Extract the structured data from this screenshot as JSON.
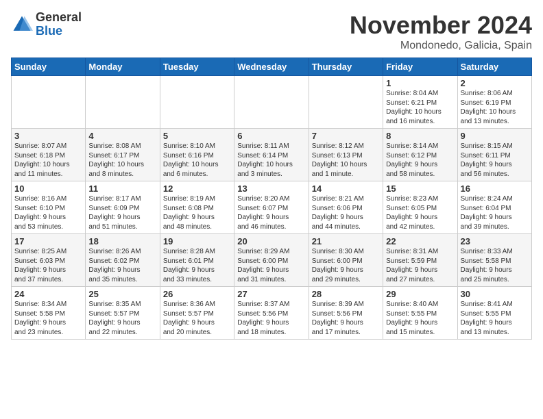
{
  "header": {
    "logo_general": "General",
    "logo_blue": "Blue",
    "month_title": "November 2024",
    "location": "Mondonedo, Galicia, Spain"
  },
  "days_of_week": [
    "Sunday",
    "Monday",
    "Tuesday",
    "Wednesday",
    "Thursday",
    "Friday",
    "Saturday"
  ],
  "weeks": [
    [
      {
        "day": "",
        "info": ""
      },
      {
        "day": "",
        "info": ""
      },
      {
        "day": "",
        "info": ""
      },
      {
        "day": "",
        "info": ""
      },
      {
        "day": "",
        "info": ""
      },
      {
        "day": "1",
        "info": "Sunrise: 8:04 AM\nSunset: 6:21 PM\nDaylight: 10 hours\nand 16 minutes."
      },
      {
        "day": "2",
        "info": "Sunrise: 8:06 AM\nSunset: 6:19 PM\nDaylight: 10 hours\nand 13 minutes."
      }
    ],
    [
      {
        "day": "3",
        "info": "Sunrise: 8:07 AM\nSunset: 6:18 PM\nDaylight: 10 hours\nand 11 minutes."
      },
      {
        "day": "4",
        "info": "Sunrise: 8:08 AM\nSunset: 6:17 PM\nDaylight: 10 hours\nand 8 minutes."
      },
      {
        "day": "5",
        "info": "Sunrise: 8:10 AM\nSunset: 6:16 PM\nDaylight: 10 hours\nand 6 minutes."
      },
      {
        "day": "6",
        "info": "Sunrise: 8:11 AM\nSunset: 6:14 PM\nDaylight: 10 hours\nand 3 minutes."
      },
      {
        "day": "7",
        "info": "Sunrise: 8:12 AM\nSunset: 6:13 PM\nDaylight: 10 hours\nand 1 minute."
      },
      {
        "day": "8",
        "info": "Sunrise: 8:14 AM\nSunset: 6:12 PM\nDaylight: 9 hours\nand 58 minutes."
      },
      {
        "day": "9",
        "info": "Sunrise: 8:15 AM\nSunset: 6:11 PM\nDaylight: 9 hours\nand 56 minutes."
      }
    ],
    [
      {
        "day": "10",
        "info": "Sunrise: 8:16 AM\nSunset: 6:10 PM\nDaylight: 9 hours\nand 53 minutes."
      },
      {
        "day": "11",
        "info": "Sunrise: 8:17 AM\nSunset: 6:09 PM\nDaylight: 9 hours\nand 51 minutes."
      },
      {
        "day": "12",
        "info": "Sunrise: 8:19 AM\nSunset: 6:08 PM\nDaylight: 9 hours\nand 48 minutes."
      },
      {
        "day": "13",
        "info": "Sunrise: 8:20 AM\nSunset: 6:07 PM\nDaylight: 9 hours\nand 46 minutes."
      },
      {
        "day": "14",
        "info": "Sunrise: 8:21 AM\nSunset: 6:06 PM\nDaylight: 9 hours\nand 44 minutes."
      },
      {
        "day": "15",
        "info": "Sunrise: 8:23 AM\nSunset: 6:05 PM\nDaylight: 9 hours\nand 42 minutes."
      },
      {
        "day": "16",
        "info": "Sunrise: 8:24 AM\nSunset: 6:04 PM\nDaylight: 9 hours\nand 39 minutes."
      }
    ],
    [
      {
        "day": "17",
        "info": "Sunrise: 8:25 AM\nSunset: 6:03 PM\nDaylight: 9 hours\nand 37 minutes."
      },
      {
        "day": "18",
        "info": "Sunrise: 8:26 AM\nSunset: 6:02 PM\nDaylight: 9 hours\nand 35 minutes."
      },
      {
        "day": "19",
        "info": "Sunrise: 8:28 AM\nSunset: 6:01 PM\nDaylight: 9 hours\nand 33 minutes."
      },
      {
        "day": "20",
        "info": "Sunrise: 8:29 AM\nSunset: 6:00 PM\nDaylight: 9 hours\nand 31 minutes."
      },
      {
        "day": "21",
        "info": "Sunrise: 8:30 AM\nSunset: 6:00 PM\nDaylight: 9 hours\nand 29 minutes."
      },
      {
        "day": "22",
        "info": "Sunrise: 8:31 AM\nSunset: 5:59 PM\nDaylight: 9 hours\nand 27 minutes."
      },
      {
        "day": "23",
        "info": "Sunrise: 8:33 AM\nSunset: 5:58 PM\nDaylight: 9 hours\nand 25 minutes."
      }
    ],
    [
      {
        "day": "24",
        "info": "Sunrise: 8:34 AM\nSunset: 5:58 PM\nDaylight: 9 hours\nand 23 minutes."
      },
      {
        "day": "25",
        "info": "Sunrise: 8:35 AM\nSunset: 5:57 PM\nDaylight: 9 hours\nand 22 minutes."
      },
      {
        "day": "26",
        "info": "Sunrise: 8:36 AM\nSunset: 5:57 PM\nDaylight: 9 hours\nand 20 minutes."
      },
      {
        "day": "27",
        "info": "Sunrise: 8:37 AM\nSunset: 5:56 PM\nDaylight: 9 hours\nand 18 minutes."
      },
      {
        "day": "28",
        "info": "Sunrise: 8:39 AM\nSunset: 5:56 PM\nDaylight: 9 hours\nand 17 minutes."
      },
      {
        "day": "29",
        "info": "Sunrise: 8:40 AM\nSunset: 5:55 PM\nDaylight: 9 hours\nand 15 minutes."
      },
      {
        "day": "30",
        "info": "Sunrise: 8:41 AM\nSunset: 5:55 PM\nDaylight: 9 hours\nand 13 minutes."
      }
    ]
  ]
}
